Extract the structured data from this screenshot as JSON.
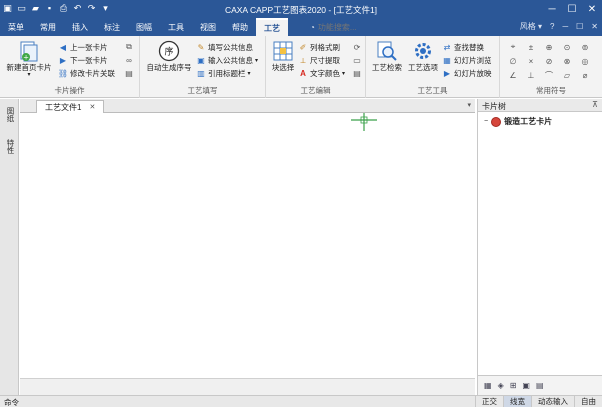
{
  "window": {
    "title": "CAXA CAPP工艺图表2020 - [工艺文件1]",
    "accent": "#2b5797"
  },
  "quick_access": [
    "app-logo-icon",
    "new-file-icon",
    "open-folder-icon",
    "save-icon",
    "print-icon",
    "undo-icon",
    "redo-icon",
    "dropdown-icon"
  ],
  "menu": {
    "tabs": [
      "菜单",
      "常用",
      "插入",
      "标注",
      "图幅",
      "工具",
      "视图",
      "帮助",
      "工艺"
    ],
    "active_tab": "工艺",
    "search_placeholder": "功能搜索...",
    "style_label": "风格"
  },
  "ribbon": {
    "card_ops": {
      "label": "卡片操作",
      "new_home_card": "新建首页卡片",
      "prev_card": "上一张卡片",
      "next_card": "下一张卡片",
      "modify_card_link": "修改卡片关联"
    },
    "process_fill": {
      "label": "工艺填写",
      "auto_seq": "自动生成序号",
      "seq_glyph": "序",
      "write_public": "填写公共信息",
      "input_public": "输入公共信息",
      "cite_title": "引用标题栏"
    },
    "process_edit": {
      "label": "工艺编辑",
      "block_select": "块选择",
      "format_brush": "列格式刷",
      "size_extract": "尺寸提取",
      "text_color": "文字颜色"
    },
    "process_tools": {
      "label": "工艺工具",
      "process_search": "工艺检索",
      "process_options": "工艺选项",
      "find_replace": "查找替换",
      "slide_browse": "幻灯片浏览",
      "slide_play": "幻灯片放映"
    },
    "common_symbols": {
      "label": "常用符号"
    }
  },
  "left_tabs": [
    "图纸",
    "特性"
  ],
  "document": {
    "tab_label": "工艺文件1"
  },
  "card_tree": {
    "header": "卡片树",
    "root_item": "锻造工艺卡片"
  },
  "status": {
    "left": "命令",
    "items": [
      "正交",
      "线宽",
      "动态输入",
      "自由"
    ],
    "active_items": [
      "线宽"
    ]
  }
}
